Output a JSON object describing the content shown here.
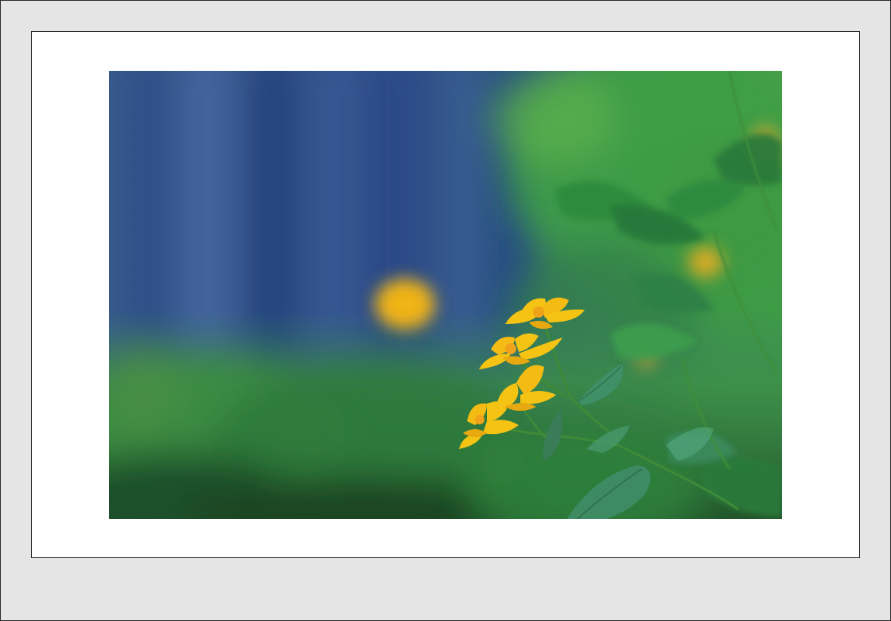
{
  "frame": {
    "background_color": "#e5e5e5",
    "mat_color": "#ffffff",
    "border_color": "#1f1f1f"
  },
  "photo": {
    "subject": "yellow-flowers-icon",
    "palette": {
      "sky_blue": "#3d5f9a",
      "deep_blue": "#2a3f7a",
      "foliage_green": "#3fa84a",
      "bright_green": "#62c24f",
      "dark_green": "#1f6b33",
      "flower_yellow": "#f5c313",
      "flower_orange": "#f0a21a",
      "stem_green": "#3d8a3a",
      "leaf_teal": "#3f8f63"
    }
  }
}
